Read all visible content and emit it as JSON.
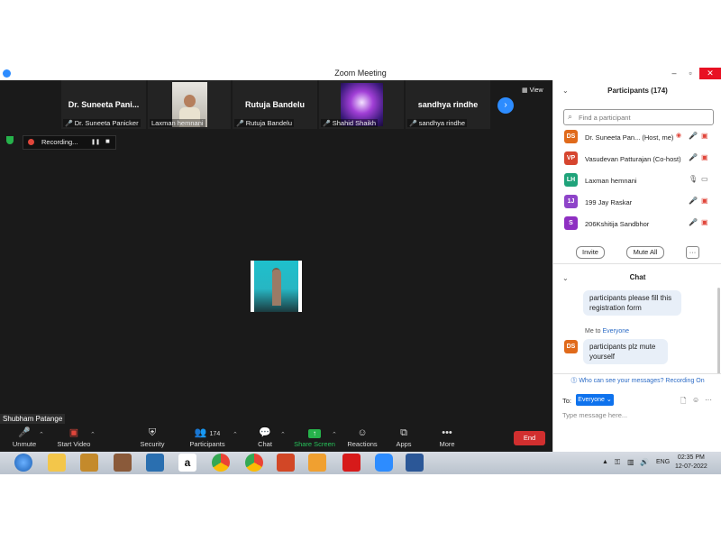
{
  "window": {
    "title": "Zoom Meeting",
    "minimize": "–",
    "maximize": "▫",
    "close": "✕"
  },
  "gallery": {
    "tiles": [
      {
        "name": "Dr. Suneeta Pani...",
        "label": "Dr. Suneeta Panicker"
      },
      {
        "name": "",
        "label": "Laxman hemnani"
      },
      {
        "name": "Rutuja Bandelu",
        "label": "Rutuja Bandelu"
      },
      {
        "name": "",
        "label": "Shahid Shaikh"
      },
      {
        "name": "sandhya rindhe",
        "label": "sandhya rindhe"
      }
    ],
    "next_icon": "›",
    "view_label": "View"
  },
  "recording": {
    "label": "Recording...",
    "pause": "❚❚",
    "stop": "■"
  },
  "active_speaker_name": "Shubham Patange",
  "toolbar": {
    "unmute": "Unmute",
    "start_video": "Start Video",
    "security": "Security",
    "participants": "Participants",
    "participants_count": "174",
    "chat": "Chat",
    "share_screen": "Share Screen",
    "reactions": "Reactions",
    "apps": "Apps",
    "more": "More",
    "end": "End"
  },
  "participants_panel": {
    "header": "Participants (174)",
    "search_placeholder": "Find a participant",
    "list": [
      {
        "initials": "DS",
        "name": "Dr. Suneeta Pan...  (Host, me)",
        "color": "#e06a1b"
      },
      {
        "initials": "VP",
        "name": "Vasudevan Patturajan (Co-host)",
        "color": "#d6452f"
      },
      {
        "initials": "LH",
        "name": "Laxman hemnani",
        "color": "#1fa37a"
      },
      {
        "initials": "1J",
        "name": "199 Jay Raskar",
        "color": "#8e44c9"
      },
      {
        "initials": "S",
        "name": "206Kshitija Sandbhor",
        "color": "#8e2fc2"
      }
    ],
    "invite": "Invite",
    "mute_all": "Mute All",
    "more": "···"
  },
  "chat_panel": {
    "header": "Chat",
    "messages": [
      {
        "text": "participants please fill this registration form"
      },
      {
        "sender_line_prefix": "Me to ",
        "sender_line_target": "Everyone",
        "initials": "DS",
        "text": "participants plz mute yourself"
      }
    ],
    "visibility_note": "Who can see your messages? Recording On",
    "to_label": "To:",
    "to_value": "Everyone ⌄",
    "input_placeholder": "Type message here..."
  },
  "taskbar": {
    "language": "ENG",
    "time": "02:35 PM",
    "date": "12-07-2022"
  }
}
